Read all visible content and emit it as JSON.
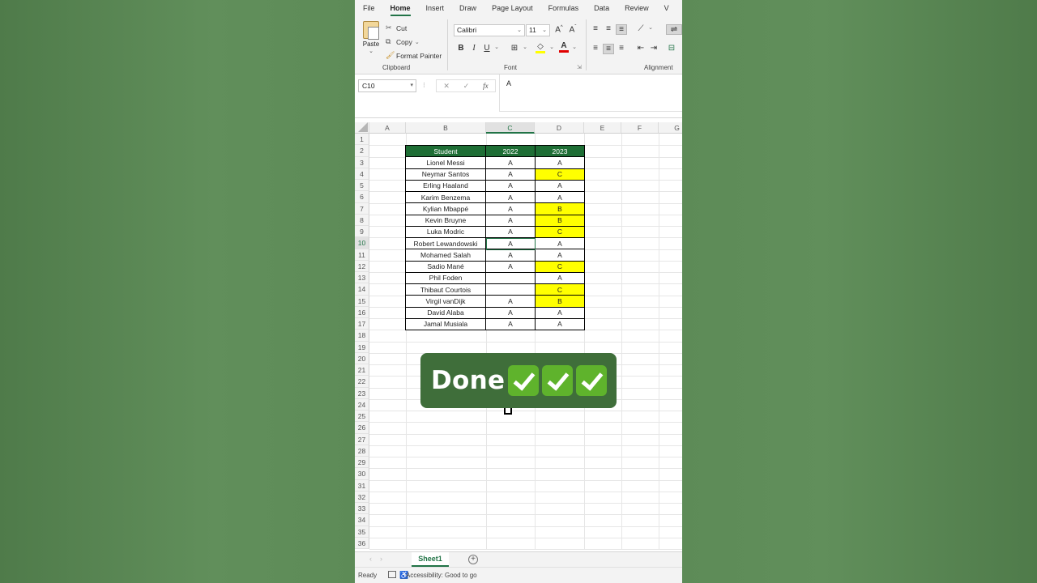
{
  "ribbon": {
    "tabs": [
      "File",
      "Home",
      "Insert",
      "Draw",
      "Page Layout",
      "Formulas",
      "Data",
      "Review",
      "V"
    ],
    "active_tab": "Home",
    "clipboard": {
      "paste": "Paste",
      "cut": "Cut",
      "copy": "Copy",
      "format_painter": "Format Painter",
      "label": "Clipboard"
    },
    "font": {
      "family": "Calibri",
      "size": "11",
      "bold": "B",
      "italic": "I",
      "underline": "U",
      "label": "Font"
    },
    "alignment": {
      "label": "Alignment"
    }
  },
  "formula_bar": {
    "name_box": "C10",
    "value": "A"
  },
  "columns": [
    "A",
    "B",
    "C",
    "D",
    "E",
    "F",
    "G"
  ],
  "selected_column": "C",
  "selected_row": 10,
  "rows": [
    "1",
    "2",
    "3",
    "4",
    "5",
    "6",
    "7",
    "8",
    "9",
    "10",
    "11",
    "12",
    "13",
    "14",
    "15",
    "16",
    "17",
    "18",
    "19",
    "20",
    "21",
    "22",
    "23",
    "24",
    "25",
    "26",
    "27",
    "28",
    "29",
    "30",
    "31",
    "32",
    "33",
    "34",
    "35",
    "36"
  ],
  "table": {
    "headers": [
      "Student",
      "2022",
      "2023"
    ],
    "rows": [
      {
        "student": "Lionel Messi",
        "y2022": "A",
        "y2023": "A",
        "highlight": false
      },
      {
        "student": "Neymar Santos",
        "y2022": "A",
        "y2023": "C",
        "highlight": true
      },
      {
        "student": "Erling Haaland",
        "y2022": "A",
        "y2023": "A",
        "highlight": false
      },
      {
        "student": "Karim Benzema",
        "y2022": "A",
        "y2023": "A",
        "highlight": false
      },
      {
        "student": "Kylian Mbappé",
        "y2022": "A",
        "y2023": "B",
        "highlight": true
      },
      {
        "student": "Kevin Bruyne",
        "y2022": "A",
        "y2023": "B",
        "highlight": true
      },
      {
        "student": "Luka Modric",
        "y2022": "A",
        "y2023": "C",
        "highlight": true
      },
      {
        "student": "Robert Lewandowski",
        "y2022": "A",
        "y2023": "A",
        "highlight": false
      },
      {
        "student": "Mohamed Salah",
        "y2022": "A",
        "y2023": "A",
        "highlight": false
      },
      {
        "student": "Sadio Mané",
        "y2022": "A",
        "y2023": "C",
        "highlight": true
      },
      {
        "student": "Phil Foden",
        "y2022": "",
        "y2023": "A",
        "highlight": false
      },
      {
        "student": "Thibaut Courtois",
        "y2022": "",
        "y2023": "C",
        "highlight": true
      },
      {
        "student": "Virgil vanDijk",
        "y2022": "A",
        "y2023": "B",
        "highlight": true
      },
      {
        "student": "David Alaba",
        "y2022": "A",
        "y2023": "A",
        "highlight": false
      },
      {
        "student": "Jamal Musiala",
        "y2022": "A",
        "y2023": "A",
        "highlight": false
      }
    ],
    "header_color": "#1e6e35",
    "highlight_color": "#ffff00"
  },
  "overlay": {
    "text": "Done",
    "icons": [
      "check-mark-icon",
      "check-mark-icon",
      "check-mark-icon"
    ]
  },
  "sheets": {
    "active": "Sheet1"
  },
  "status": {
    "ready": "Ready",
    "accessibility": "Accessibility: Good to go"
  }
}
